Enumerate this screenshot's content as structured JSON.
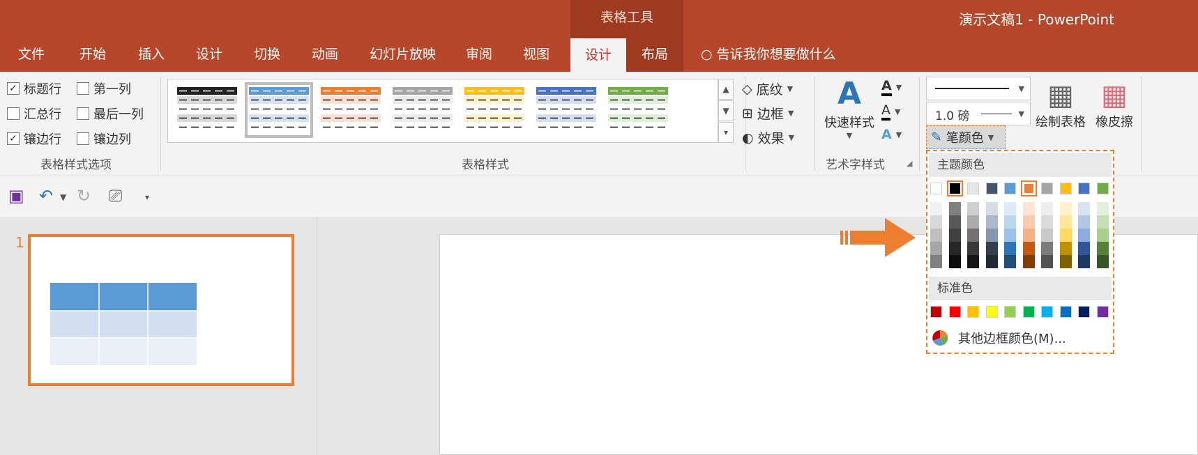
{
  "window": {
    "title": "演示文稿1 - PowerPoint",
    "context_group": "表格工具"
  },
  "tabs": [
    "文件",
    "开始",
    "插入",
    "设计",
    "切换",
    "动画",
    "幻灯片放映",
    "审阅",
    "视图",
    "设计",
    "布局"
  ],
  "active_tab_index": 9,
  "tell_me": "告诉我你想要做什么",
  "style_options": {
    "label": "表格样式选项",
    "items": [
      {
        "label": "标题行",
        "checked": true
      },
      {
        "label": "第一列",
        "checked": false
      },
      {
        "label": "汇总行",
        "checked": false
      },
      {
        "label": "最后一列",
        "checked": false
      },
      {
        "label": "镶边行",
        "checked": true
      },
      {
        "label": "镶边列",
        "checked": false
      }
    ]
  },
  "table_styles": {
    "label": "表格样式",
    "styles": [
      {
        "head": "#222222",
        "band": "#d9d9d9",
        "selected": false
      },
      {
        "head": "#5b9bd5",
        "band": "#d6e3f3",
        "selected": true
      },
      {
        "head": "#ed7d31",
        "band": "#fbe0d2",
        "selected": false
      },
      {
        "head": "#a5a5a5",
        "band": "#ececec",
        "selected": false
      },
      {
        "head": "#ffc000",
        "band": "#fff1cc",
        "selected": false
      },
      {
        "head": "#4472c4",
        "band": "#d6dff2",
        "selected": false
      },
      {
        "head": "#70ad47",
        "band": "#e0efd8",
        "selected": false
      }
    ],
    "shading": "底纹",
    "borders": "边框",
    "effects": "效果"
  },
  "wordart": {
    "label": "艺术字样式",
    "quick_styles": "快速样式"
  },
  "draw_borders": {
    "pen_weight": "1.0 磅",
    "pen_color": "笔颜色",
    "draw_table": "绘制表格",
    "eraser": "橡皮擦"
  },
  "color_menu": {
    "theme_header": "主题颜色",
    "standard_header": "标准色",
    "more_colors": "其他边框颜色(M)...",
    "theme_top": [
      "#ffffff",
      "#000000",
      "#e7e6e6",
      "#44546a",
      "#5b9bd5",
      "#ed7d31",
      "#a5a5a5",
      "#ffc000",
      "#4472c4",
      "#70ad47"
    ],
    "theme_shades": [
      [
        "#f2f2f2",
        "#d9d9d9",
        "#bfbfbf",
        "#a6a6a6",
        "#808080"
      ],
      [
        "#808080",
        "#595959",
        "#404040",
        "#262626",
        "#0d0d0d"
      ],
      [
        "#d0cece",
        "#aeabab",
        "#757171",
        "#3a3838",
        "#171616"
      ],
      [
        "#d6dce4",
        "#adb9ca",
        "#8497b0",
        "#333f4f",
        "#222a35"
      ],
      [
        "#deebf6",
        "#bdd7ee",
        "#9dc3e6",
        "#2e75b6",
        "#1f4e79"
      ],
      [
        "#fbe5d5",
        "#f8cbad",
        "#f4b183",
        "#c55a11",
        "#843c0b"
      ],
      [
        "#ededed",
        "#dbdbdb",
        "#c9c9c9",
        "#7b7b7b",
        "#525252"
      ],
      [
        "#fff2cc",
        "#fee599",
        "#ffd965",
        "#bf9000",
        "#7f6000"
      ],
      [
        "#dae3f3",
        "#b4c7e7",
        "#8faadc",
        "#2f5597",
        "#1f3864"
      ],
      [
        "#e2efd9",
        "#c5e0b3",
        "#a8d08d",
        "#538135",
        "#375623"
      ]
    ],
    "standard": [
      "#c00000",
      "#ff0000",
      "#ffc000",
      "#ffff00",
      "#92d050",
      "#00b050",
      "#00b0f0",
      "#0070c0",
      "#002060",
      "#7030a0"
    ],
    "selected_index": 1,
    "hover_index": 5
  },
  "slides": {
    "number": "1"
  },
  "colors": {
    "accent": "#b7472a",
    "highlight": "#ed7d31"
  }
}
